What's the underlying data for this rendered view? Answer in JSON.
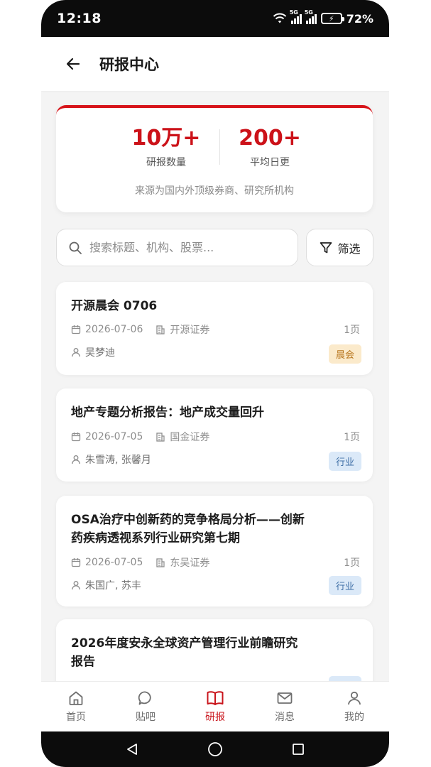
{
  "status_bar": {
    "time": "12:18",
    "network_label_1": "5G",
    "network_label_2": "5G",
    "battery": "72%"
  },
  "header": {
    "title": "研报中心"
  },
  "stats": {
    "reports_count": "10万+",
    "reports_label": "研报数量",
    "daily_count": "200+",
    "daily_label": "平均日更",
    "source_note": "来源为国内外顶级券商、研究所机构"
  },
  "search": {
    "placeholder": "搜索标题、机构、股票...",
    "value": ""
  },
  "filter": {
    "label": "筛选"
  },
  "reports": [
    {
      "title": "开源晨会 0706",
      "date": "2026-07-06",
      "broker": "开源证券",
      "pages": "1页",
      "authors": "吴梦迪",
      "tag": "晨会"
    },
    {
      "title": "地产专题分析报告：地产成交量回升",
      "date": "2026-07-05",
      "broker": "国金证券",
      "pages": "1页",
      "authors": "朱雪涛, 张馨月",
      "tag": "行业"
    },
    {
      "title_line1": "OSA治疗中创新药的竞争格局分析——创新",
      "title_line2": "药疾病透视系列行业研究第七期",
      "date": "2026-07-05",
      "broker": "东吴证券",
      "pages": "1页",
      "authors": "朱国广, 苏丰",
      "tag": "行业"
    },
    {
      "title_line1": "2026年度安永全球资产管理行业前瞻研究",
      "title_line2": "报告"
    }
  ],
  "bottom_nav": {
    "items": [
      {
        "label": "首页",
        "icon": "home-icon"
      },
      {
        "label": "贴吧",
        "icon": "chat-bubble-icon"
      },
      {
        "label": "研报",
        "icon": "book-icon",
        "active": true
      },
      {
        "label": "消息",
        "icon": "mail-icon"
      },
      {
        "label": "我的",
        "icon": "person-icon"
      }
    ]
  },
  "colors": {
    "accent": "#cc1219",
    "morning_tag_bg": "#fbeacb",
    "industry_tag_bg": "#dbe9f8"
  }
}
